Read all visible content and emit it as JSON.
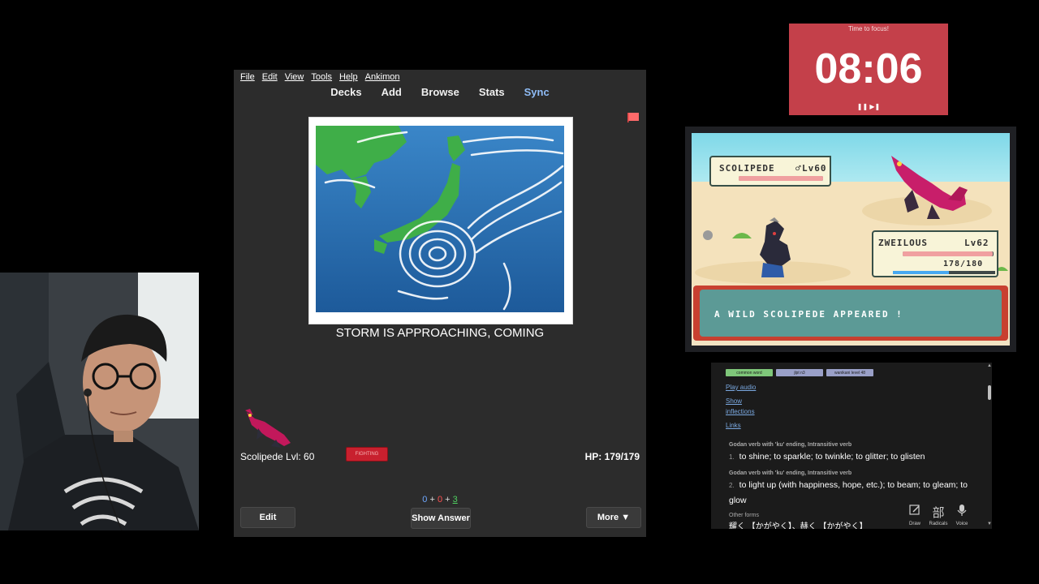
{
  "anki": {
    "menu": [
      "File",
      "Edit",
      "View",
      "Tools",
      "Help",
      "Ankimon"
    ],
    "toolbar": {
      "decks": "Decks",
      "add": "Add",
      "browse": "Browse",
      "stats": "Stats",
      "sync": "Sync"
    },
    "prompt": "STORM IS APPROACHING, COMING",
    "monster_label": "Scolipede Lvl: 60",
    "type_badge": "FIGHTING",
    "hp": "HP: 179/179",
    "counts": {
      "new": "0",
      "learn": "0",
      "review": "3"
    },
    "buttons": {
      "edit": "Edit",
      "show_answer": "Show Answer",
      "more": "More ▼"
    },
    "colors": {
      "new": "#6fa8ff",
      "learn": "#ff5050",
      "review": "#4fd060"
    }
  },
  "timer": {
    "title": "Time to focus!",
    "time": "08:06",
    "controls": "❚❚ ▶❚"
  },
  "battle": {
    "enemy": {
      "name": "SCOLIPEDE",
      "gender": "♂",
      "level": "Lv60",
      "hp_fraction": 1.0
    },
    "player": {
      "name": "ZWEILOUS",
      "level": "Lv62",
      "hp": "178/180",
      "hp_fraction": 0.99,
      "exp_fraction": 0.55
    },
    "message": "A WILD SCOLIPEDE APPEARED !"
  },
  "dictionary": {
    "tags": [
      "common word",
      "jlpt n3",
      "wanikani level 48"
    ],
    "play_audio": "Play audio",
    "show_inflections_1": "Show",
    "show_inflections_2": "inflections",
    "links": "Links",
    "senses": [
      {
        "pos": "Godan verb with 'ku' ending, Intransitive verb",
        "num": "1.",
        "def": "to shine; to sparkle; to twinkle; to glitter; to glisten"
      },
      {
        "pos": "Godan verb with 'ku' ending, Intransitive verb",
        "num": "2.",
        "def": "to light up (with happiness, hope, etc.); to beam; to gleam; to glow"
      }
    ],
    "other_forms_title": "Other forms",
    "other_forms": "耀く 【かがやく】、赫く 【かがやく】",
    "tools": {
      "draw": "Draw",
      "radicals": "Radicals",
      "voice": "Voice",
      "radicals_glyph": "部"
    }
  }
}
